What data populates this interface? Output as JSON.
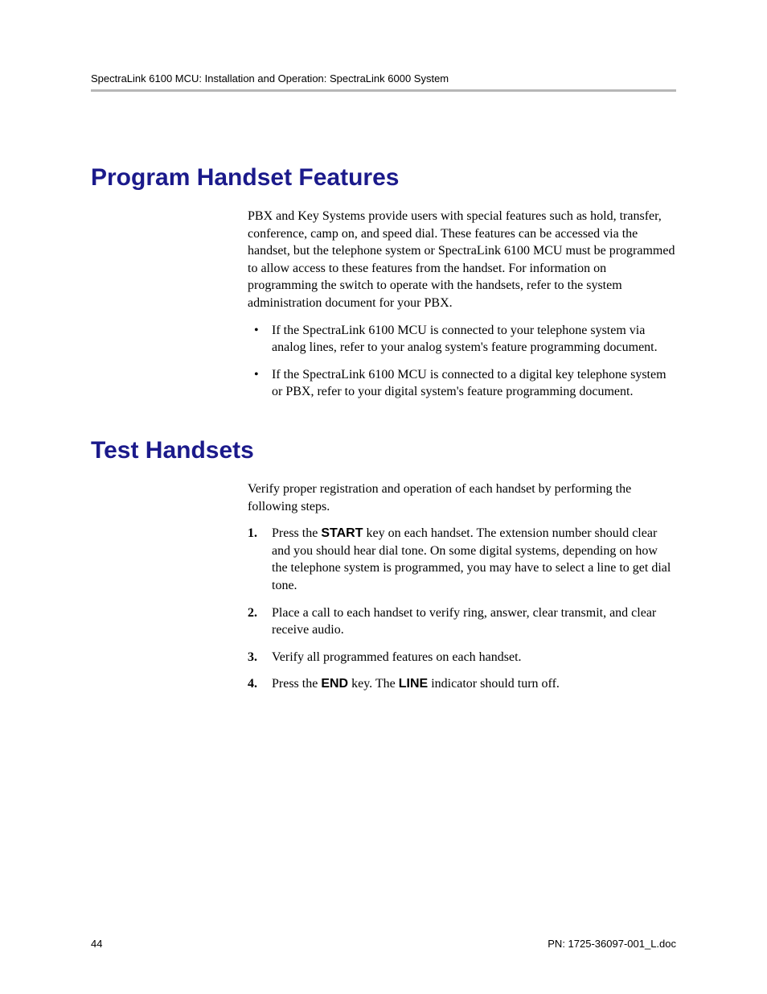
{
  "header": {
    "text": "SpectraLink 6100 MCU: Installation and Operation: SpectraLink 6000 System"
  },
  "sections": {
    "program": {
      "heading": "Program Handset Features",
      "intro": "PBX and Key Systems provide users with special features such as hold, transfer, conference, camp on, and speed dial. These features can be accessed via the handset, but the telephone system or SpectraLink 6100 MCU must be programmed to allow access to these features from the handset. For information on programming the switch to operate with the handsets, refer to the system administration document for your PBX.",
      "bullets": [
        "If the SpectraLink 6100 MCU is connected to your telephone system via analog lines, refer to your analog system's feature programming document.",
        "If the SpectraLink 6100 MCU is connected to a digital key telephone system or PBX, refer to your digital system's feature programming document."
      ]
    },
    "test": {
      "heading": "Test Handsets",
      "intro": "Verify proper registration and operation of each handset by performing the following steps.",
      "steps": [
        {
          "pre": "Press the ",
          "key1": "START",
          "post": " key on each handset. The extension number should clear and you should hear dial tone. On some digital systems, depending on how the telephone system is programmed, you may have to select a line to get dial tone."
        },
        {
          "pre": "Place a call to each handset to verify ring, answer, clear transmit, and clear receive audio.",
          "key1": "",
          "post": ""
        },
        {
          "pre": "Verify all programmed features on each handset.",
          "key1": "",
          "post": ""
        },
        {
          "pre": "Press the ",
          "key1": "END",
          "mid": " key. The ",
          "key2": "LINE",
          "post": " indicator should turn off."
        }
      ]
    }
  },
  "footer": {
    "page": "44",
    "pn": "PN: 1725-36097-001_L.doc"
  }
}
